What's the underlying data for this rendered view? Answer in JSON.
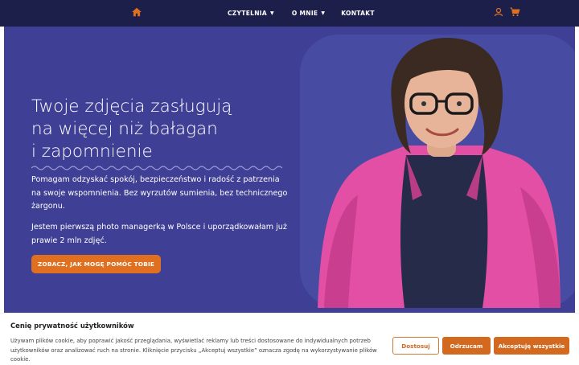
{
  "nav": {
    "items": [
      {
        "label": "CZYTELNIA",
        "has_caret": true
      },
      {
        "label": "O MNIE",
        "has_caret": true
      },
      {
        "label": "KONTAKT",
        "has_caret": false
      }
    ],
    "icons": [
      "home-icon",
      "user-icon",
      "cart-icon"
    ],
    "accent": "#e0701f"
  },
  "hero": {
    "heading": [
      "Twoje zdjęcia zasługują",
      "na więcej niż bałagan",
      "i zapomnienie"
    ],
    "paragraph1": "Pomagam odzyskać spokój, bezpieczeństwo i radość z patrzenia na swoje wspomnienia. Bez wyrzutów sumienia, bez technicznego żargonu.",
    "paragraph2": "Jestem pierwszą photo managerką w Polsce i uporządkowałam już prawie 2 mln zdjęć.",
    "cta_label": "ZOBACZ, JAK MOGĘ POMÓC TOBIE",
    "background": "#3f3f96"
  },
  "cookie": {
    "title": "Cenię prywatność użytkowników",
    "text": "Używam plików cookie, aby poprawić jakość przeglądania, wyświetlać reklamy lub treści dostosowane do indywidualnych potrzeb użytkowników oraz analizować ruch na stronie. Kliknięcie przycisku „Akceptuj wszystkie” oznacza zgodę na wykorzystywanie plików cookie.",
    "buttons": {
      "customize": "Dostosuj",
      "reject": "Odrzucam",
      "accept": "Akceptuję wszystkie"
    }
  }
}
